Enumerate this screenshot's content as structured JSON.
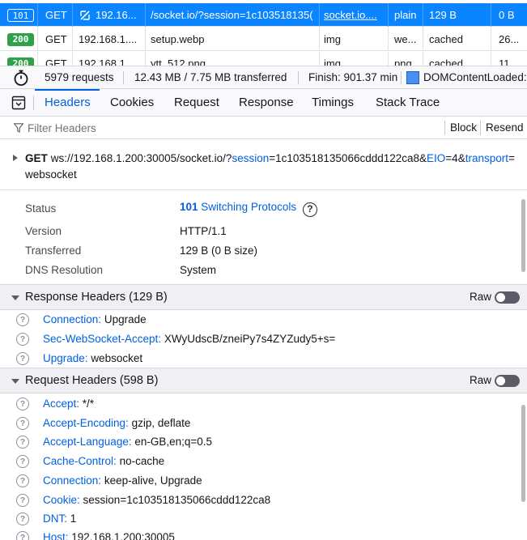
{
  "request_list": [
    {
      "status": "101",
      "method": "GET",
      "domain": "192.16...",
      "file": "/socket.io/?session=1c103518135(",
      "initiator": "socket.io....",
      "type": "plain",
      "transferred": "129 B",
      "size": "0 B",
      "selected": true
    },
    {
      "status": "200",
      "method": "GET",
      "domain": "192.168.1....",
      "file": "setup.webp",
      "initiator": "img",
      "type": "we...",
      "transferred": "cached",
      "size": "26...",
      "selected": false
    },
    {
      "status": "200",
      "method": "GET",
      "domain": "192.168.1....",
      "file": "ytt_512.png",
      "initiator": "img",
      "type": "png",
      "transferred": "cached",
      "size": "11...",
      "selected": false
    }
  ],
  "summary": {
    "requests": "5979 requests",
    "transferred": "12.43 MB / 7.75 MB transferred",
    "finish": "Finish: 901.37 min",
    "dom": "DOMContentLoaded:"
  },
  "tabs": [
    "Headers",
    "Cookies",
    "Request",
    "Response",
    "Timings",
    "Stack Trace"
  ],
  "filter": {
    "placeholder": "Filter Headers",
    "block_label": "Block",
    "resend_label": "Resend"
  },
  "url": {
    "method": "GET",
    "base": "ws://192.168.1.200:30005/socket.io/?",
    "p1_key": "session",
    "p1_eq": "=1c103518135066cddd122ca8&",
    "p2_key": "EIO",
    "p2_eq": "=4&",
    "p3_key": "transport",
    "p3_eq": "=websocket"
  },
  "status_info": {
    "status_label": "Status",
    "status_code": "101",
    "status_text": "Switching Protocols",
    "version_label": "Version",
    "version_value": "HTTP/1.1",
    "transferred_label": "Transferred",
    "transferred_value": "129 B (0 B size)",
    "dns_label": "DNS Resolution",
    "dns_value": "System"
  },
  "response_headers": {
    "title": "Response Headers (129 B)",
    "raw_label": "Raw",
    "items": [
      {
        "name": "Connection:",
        "value": "Upgrade"
      },
      {
        "name": "Sec-WebSocket-Accept:",
        "value": "XWyUdscB/zneiPy7s4ZYZudy5+s="
      },
      {
        "name": "Upgrade:",
        "value": "websocket"
      }
    ]
  },
  "request_headers": {
    "title": "Request Headers (598 B)",
    "raw_label": "Raw",
    "items": [
      {
        "name": "Accept:",
        "value": "*/*"
      },
      {
        "name": "Accept-Encoding:",
        "value": "gzip, deflate"
      },
      {
        "name": "Accept-Language:",
        "value": "en-GB,en;q=0.5"
      },
      {
        "name": "Cache-Control:",
        "value": "no-cache"
      },
      {
        "name": "Connection:",
        "value": "keep-alive, Upgrade"
      },
      {
        "name": "Cookie:",
        "value": "session=1c103518135066cddd122ca8"
      },
      {
        "name": "DNT:",
        "value": "1"
      },
      {
        "name": "Host:",
        "value": "192.168.1.200:30005"
      }
    ]
  },
  "help_glyph": "?",
  "colors": {
    "accent": "#0061e0",
    "selected_row": "#0a84ff",
    "status_ok": "#30a04a",
    "dom_loaded": "#4a90f0"
  },
  "icons": {
    "stopwatch": "stopwatch-icon",
    "panel": "toggle-panel-icon",
    "filter": "filter-icon",
    "blocked": "no-entry-icon",
    "help": "help-icon"
  }
}
